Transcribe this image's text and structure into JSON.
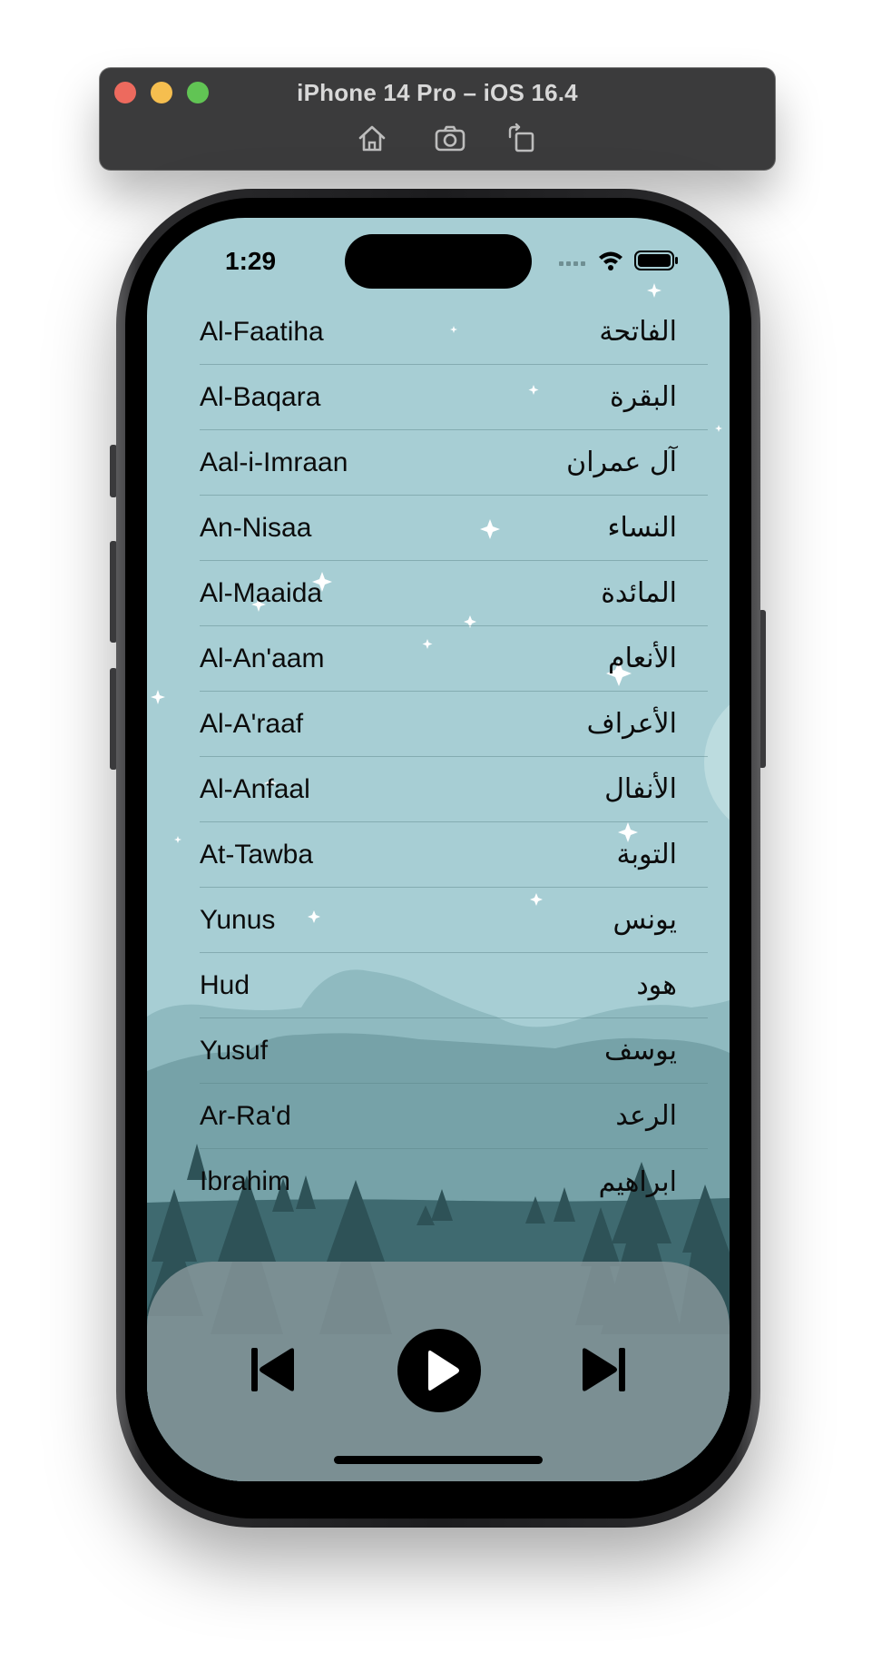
{
  "simulator": {
    "title": "iPhone 14 Pro – iOS 16.4",
    "toolbar_icons": [
      "home-icon",
      "screenshot-icon",
      "rotate-icon"
    ]
  },
  "status_bar": {
    "time": "1:29",
    "icons": [
      "cellular-icon",
      "wifi-icon",
      "battery-icon"
    ]
  },
  "surahs": [
    {
      "name": "Al-Faatiha",
      "arabic": "الفاتحة"
    },
    {
      "name": "Al-Baqara",
      "arabic": "البقرة"
    },
    {
      "name": "Aal-i-Imraan",
      "arabic": "آل عمران"
    },
    {
      "name": "An-Nisaa",
      "arabic": "النساء"
    },
    {
      "name": "Al-Maaida",
      "arabic": "المائدة"
    },
    {
      "name": "Al-An'aam",
      "arabic": "الأنعام"
    },
    {
      "name": "Al-A'raaf",
      "arabic": "الأعراف"
    },
    {
      "name": "Al-Anfaal",
      "arabic": "الأنفال"
    },
    {
      "name": "At-Tawba",
      "arabic": "التوبة"
    },
    {
      "name": "Yunus",
      "arabic": "يونس"
    },
    {
      "name": "Hud",
      "arabic": "هود"
    },
    {
      "name": "Yusuf",
      "arabic": "يوسف"
    },
    {
      "name": "Ar-Ra'd",
      "arabic": "الرعد"
    },
    {
      "name": "Ibrahim",
      "arabic": "ابراهيم"
    }
  ],
  "player": {
    "controls": [
      "previous-track-icon",
      "play-icon",
      "next-track-icon"
    ]
  },
  "colors": {
    "sky": "#a7ced4",
    "hills_light": "#8fbac0",
    "hills_mid": "#76a2a8",
    "hills_dark": "#3f6a70",
    "trees": "#2e5257",
    "player_panel": "#8c9a9e",
    "star": "#ffffff"
  }
}
